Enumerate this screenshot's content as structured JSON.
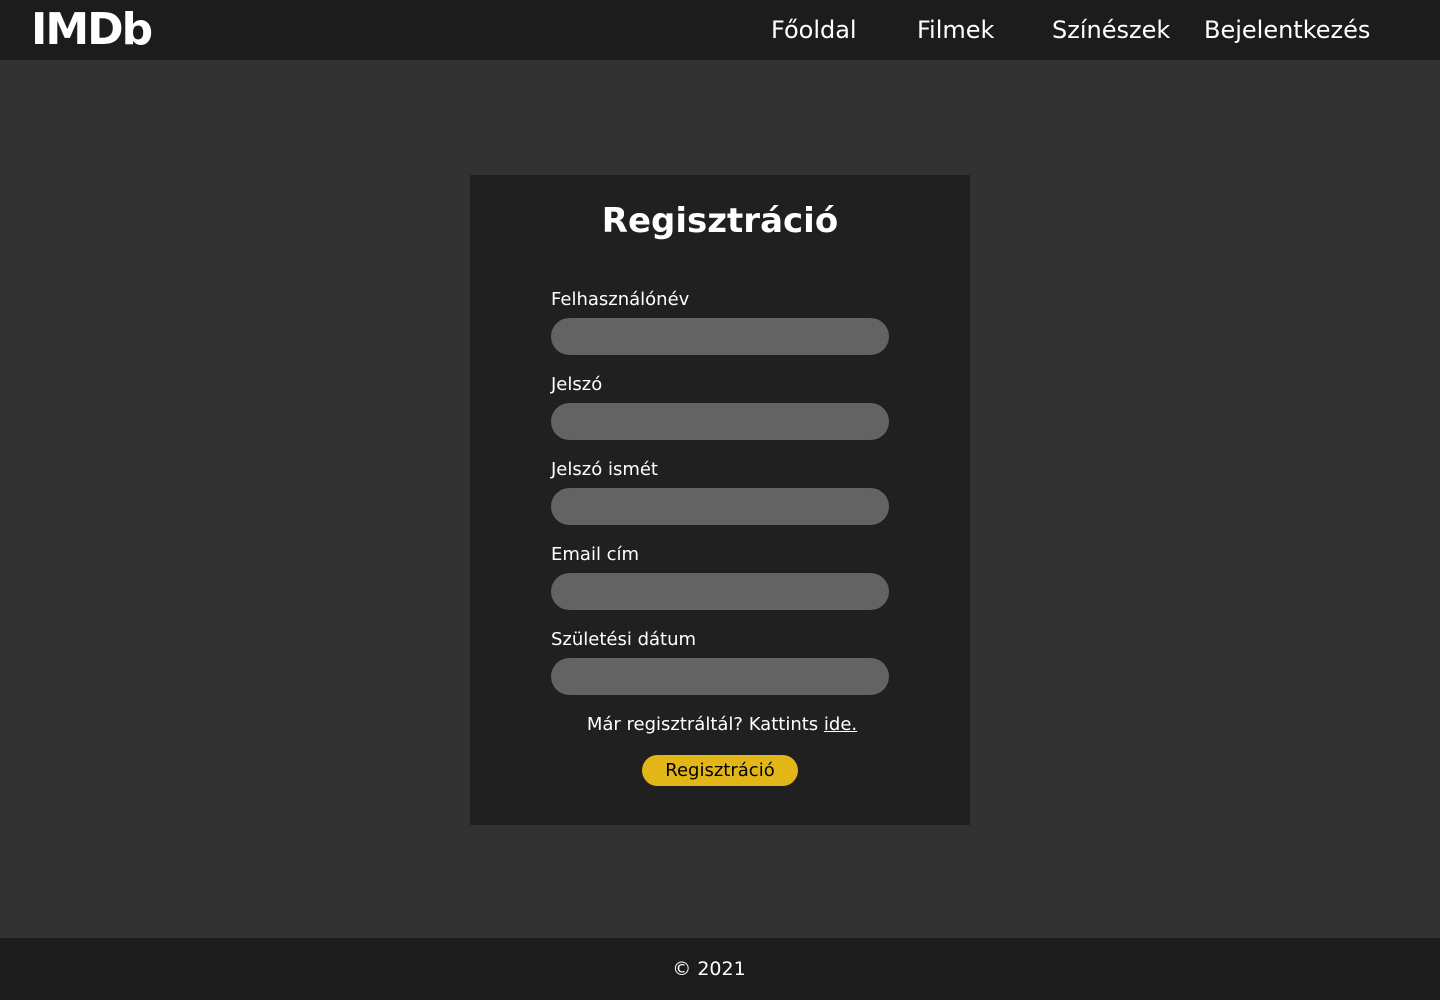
{
  "header": {
    "logo": "IMDb",
    "nav": {
      "home": "Főoldal",
      "movies": "Filmek",
      "actors": "Színészek",
      "login": "Bejelentkezés"
    }
  },
  "form": {
    "title": "Regisztráció",
    "fields": {
      "username": {
        "label": "Felhasználónév",
        "value": ""
      },
      "password": {
        "label": "Jelszó",
        "value": ""
      },
      "password_again": {
        "label": "Jelszó ismét",
        "value": ""
      },
      "email": {
        "label": "Email cím",
        "value": ""
      },
      "birth_date": {
        "label": "Születési dátum",
        "value": ""
      }
    },
    "login_hint": "Már regisztráltál? Kattints",
    "login_link": "ide.",
    "submit_label": "Regisztráció"
  },
  "footer": {
    "copyright": "© 2021"
  },
  "colors": {
    "navbar_bg": "#1c1c1c",
    "page_bg": "#323232",
    "card_bg": "#202020",
    "input_bg": "#636363",
    "accent": "#e2b616"
  }
}
